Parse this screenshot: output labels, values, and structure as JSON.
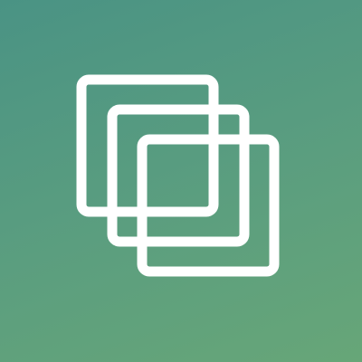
{
  "app_icon": {
    "icon_name": "overlapping-squares-icon",
    "background_colors": [
      "#4a9384",
      "#5b9e7f",
      "#67a678"
    ],
    "stroke_color": "#ffffff"
  }
}
